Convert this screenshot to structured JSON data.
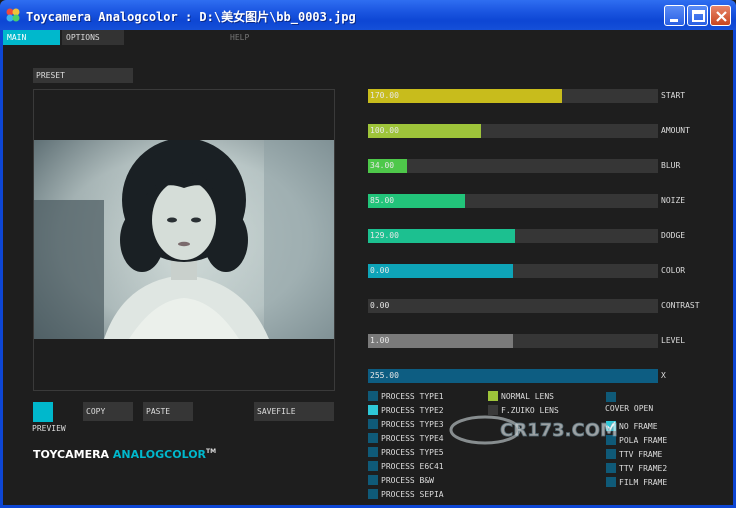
{
  "window": {
    "title": "Toycamera Analogcolor : D:\\美女图片\\bb_0003.jpg",
    "title_color": "#1a55e0"
  },
  "tabs": [
    {
      "label": "MAIN",
      "active": true
    },
    {
      "label": "OPTIONS",
      "active": false
    },
    {
      "label": "HELP",
      "active": false
    }
  ],
  "left": {
    "preset_label": "PRESET",
    "preview_label": "PREVIEW",
    "copy_label": "COPY",
    "paste_label": "PASTE",
    "savefile_label": "SAVEFILE",
    "logo_word1": "TOYCAMERA",
    "logo_word2": "ANALOGCOLOR",
    "logo_tm": "TM"
  },
  "sliders": [
    {
      "label": "START",
      "value": "170.00",
      "fill": 0.67,
      "color": "#c8bc1c"
    },
    {
      "label": "AMOUNT",
      "value": "100.00",
      "fill": 0.39,
      "color": "#9ec43a"
    },
    {
      "label": "BLUR",
      "value": "34.00",
      "fill": 0.135,
      "color": "#4ec84a"
    },
    {
      "label": "NOIZE",
      "value": "85.00",
      "fill": 0.335,
      "color": "#22c47a"
    },
    {
      "label": "DODGE",
      "value": "129.00",
      "fill": 0.506,
      "color": "#1cc090"
    },
    {
      "label": "COLOR",
      "value": "0.00",
      "fill": 0.5,
      "color": "#0ea4b8"
    },
    {
      "label": "CONTRAST",
      "value": "0.00",
      "fill": 0.0,
      "color": "#3a3a3a"
    },
    {
      "label": "LEVEL",
      "value": "1.00",
      "fill": 0.5,
      "color": "#7a7a7a"
    },
    {
      "label": "X",
      "value": "255.00",
      "fill": 1.0,
      "color": "#0d5d82"
    }
  ],
  "process": [
    {
      "label": "PROCESS TYPE1",
      "checked": false
    },
    {
      "label": "PROCESS TYPE2",
      "checked": true
    },
    {
      "label": "PROCESS TYPE3",
      "checked": false
    },
    {
      "label": "PROCESS TYPE4",
      "checked": false
    },
    {
      "label": "PROCESS TYPE5",
      "checked": false
    },
    {
      "label": "PROCESS E6C41",
      "checked": false
    },
    {
      "label": "PROCESS B&W",
      "checked": false
    },
    {
      "label": "PROCESS SEPIA",
      "checked": false
    }
  ],
  "lens": [
    {
      "label": "NORMAL LENS",
      "checked": true
    },
    {
      "label": "F.ZUIKO LENS",
      "checked": false
    }
  ],
  "cover_open_label": "COVER OPEN",
  "frames": [
    {
      "label": "NO FRAME",
      "checked": true
    },
    {
      "label": "POLA FRAME",
      "checked": false
    },
    {
      "label": "TTV FRAME",
      "checked": false
    },
    {
      "label": "TTV FRAME2",
      "checked": false
    },
    {
      "label": "FILM FRAME",
      "checked": false
    }
  ],
  "watermark_text": "CR173.COM"
}
